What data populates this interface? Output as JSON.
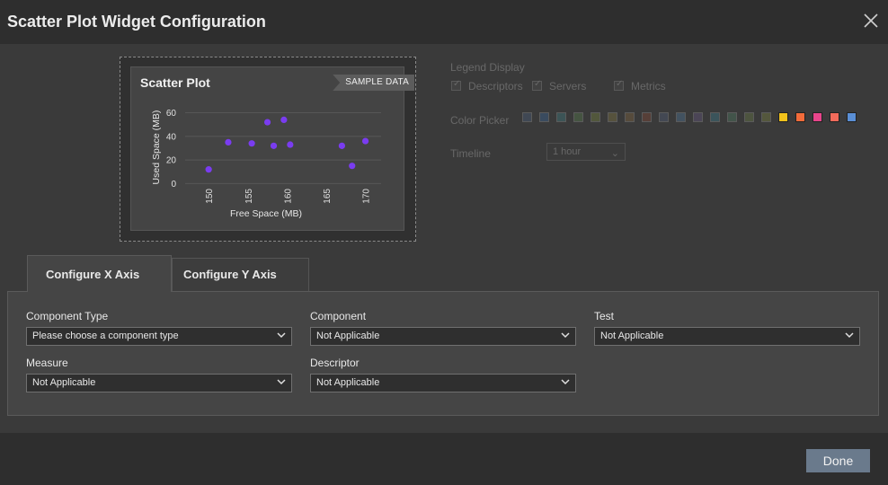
{
  "dialog": {
    "title": "Scatter Plot Widget Configuration"
  },
  "preview": {
    "card_title": "Scatter Plot",
    "badge": "SAMPLE DATA"
  },
  "chart_data": {
    "type": "scatter",
    "xlabel": "Free Space (MB)",
    "ylabel": "Used Space (MB)",
    "xlim": [
      147,
      172
    ],
    "ylim": [
      -5,
      68
    ],
    "x_ticks": [
      "150",
      "155",
      "160",
      "165",
      "170"
    ],
    "y_ticks": [
      "0",
      "20",
      "40",
      "60"
    ],
    "grid": true,
    "color": "#7a3cf0",
    "points": [
      {
        "x": 150,
        "y": 12
      },
      {
        "x": 152.5,
        "y": 35
      },
      {
        "x": 155.5,
        "y": 34
      },
      {
        "x": 157.5,
        "y": 52
      },
      {
        "x": 158.3,
        "y": 32
      },
      {
        "x": 159.6,
        "y": 54
      },
      {
        "x": 160.4,
        "y": 33
      },
      {
        "x": 167,
        "y": 32
      },
      {
        "x": 168.3,
        "y": 15
      },
      {
        "x": 170,
        "y": 36
      }
    ]
  },
  "legend_display": {
    "label": "Legend Display",
    "options": [
      {
        "label": "Descriptors",
        "checked": true
      },
      {
        "label": "Servers",
        "checked": true
      },
      {
        "label": "Metrics",
        "checked": true
      }
    ]
  },
  "color_picker": {
    "label": "Color Picker",
    "colors": [
      "#46546a",
      "#3a5a7e",
      "#3f6b6d",
      "#4f6b47",
      "#66703e",
      "#6e6640",
      "#6e5a3e",
      "#6e4438",
      "#4c5468",
      "#4a6680",
      "#5a4e6e",
      "#3c6a76",
      "#4a6a58",
      "#5e6a44",
      "#6a7040",
      "#f2c21b",
      "#f26b3a",
      "#e8458b",
      "#f26b5b",
      "#5a8fd6"
    ],
    "bright_from": 15
  },
  "timeline": {
    "label": "Timeline",
    "value": "1 hour"
  },
  "tabs": [
    {
      "label": "Configure X Axis",
      "active": true
    },
    {
      "label": "Configure Y Axis",
      "active": false
    }
  ],
  "fields": {
    "component_type": {
      "label": "Component Type",
      "value": "Please choose a component type"
    },
    "component": {
      "label": "Component",
      "value": "Not Applicable"
    },
    "test": {
      "label": "Test",
      "value": "Not Applicable"
    },
    "measure": {
      "label": "Measure",
      "value": "Not Applicable"
    },
    "descriptor": {
      "label": "Descriptor",
      "value": "Not Applicable"
    }
  },
  "footer": {
    "done_label": "Done"
  }
}
